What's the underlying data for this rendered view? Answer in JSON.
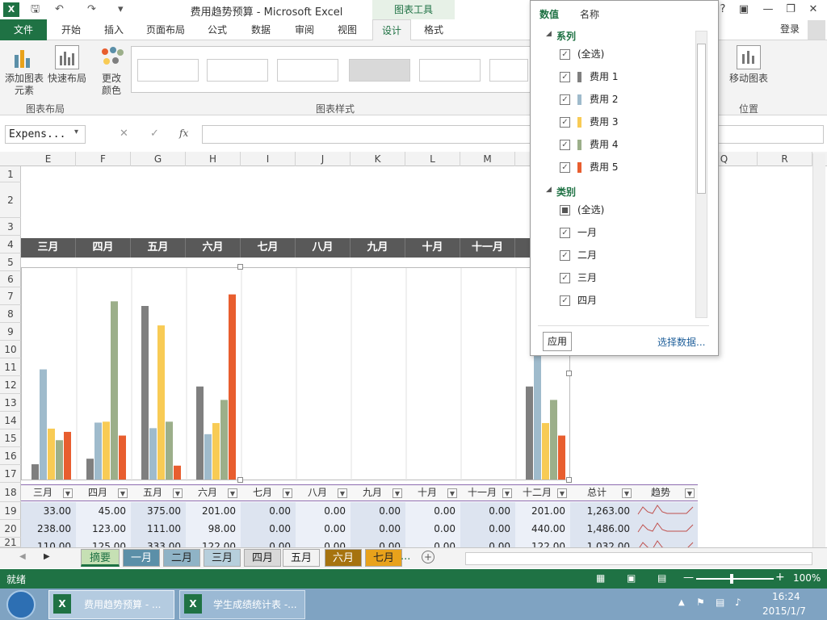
{
  "window": {
    "title": "费用趋势预算 - Microsoft Excel",
    "context_tab": "图表工具",
    "login": "登录"
  },
  "tabs": [
    "文件",
    "开始",
    "插入",
    "页面布局",
    "公式",
    "数据",
    "审阅",
    "视图",
    "设计",
    "格式"
  ],
  "ribbon": {
    "add_element": "添加图表\n元素",
    "quick_layout": "快速布局",
    "change_color": "更改\n颜色",
    "group_layout": "图表布局",
    "group_styles": "图表样式",
    "move_chart": "移动图表",
    "group_position": "位置"
  },
  "formula_bar": {
    "name_box": "Expens...",
    "fx": "fx"
  },
  "columns": [
    "E",
    "F",
    "G",
    "H",
    "I",
    "J",
    "K",
    "L",
    "M",
    "N",
    "O",
    "P",
    "Q",
    "R"
  ],
  "rows": [
    "1",
    "2",
    "3",
    "4",
    "5",
    "6",
    "7",
    "8",
    "9",
    "10",
    "11",
    "12",
    "13",
    "14",
    "15",
    "16",
    "17",
    "18",
    "19",
    "20",
    "21"
  ],
  "month_header": [
    "三月",
    "四月",
    "五月",
    "六月",
    "七月",
    "八月",
    "九月",
    "十月",
    "十一月",
    "十"
  ],
  "chart_data": {
    "type": "bar",
    "categories": [
      "三月",
      "四月",
      "五月",
      "六月",
      "七月",
      "八月",
      "九月",
      "十月",
      "十一月",
      "十二月"
    ],
    "series": [
      {
        "name": "费用 1",
        "color": "#7f7f7f",
        "values": [
          33,
          45,
          375,
          201,
          0,
          0,
          0,
          0,
          0,
          201
        ]
      },
      {
        "name": "费用 2",
        "color": "#9fbbcc",
        "values": [
          238,
          123,
          111,
          98,
          0,
          0,
          0,
          0,
          0,
          440
        ]
      },
      {
        "name": "费用 3",
        "color": "#f8cb55",
        "values": [
          110,
          125,
          333,
          122,
          0,
          0,
          0,
          0,
          0,
          122
        ]
      },
      {
        "name": "费用 4",
        "color": "#9caf8a",
        "values": [
          85,
          385,
          125,
          172,
          0,
          0,
          0,
          0,
          0,
          172
        ]
      },
      {
        "name": "费用 5",
        "color": "#e85e2f",
        "values": [
          103,
          95,
          30,
          400,
          0,
          0,
          0,
          0,
          0,
          95
        ]
      }
    ],
    "ylim": [
      0,
      450
    ]
  },
  "table": {
    "headers": [
      "三月",
      "四月",
      "五月",
      "六月",
      "七月",
      "八月",
      "九月",
      "十月",
      "十一月",
      "十二月",
      "总计",
      "趋势"
    ],
    "rows": [
      [
        "33.00",
        "45.00",
        "375.00",
        "201.00",
        "0.00",
        "0.00",
        "0.00",
        "0.00",
        "0.00",
        "201.00",
        "1,263.00"
      ],
      [
        "238.00",
        "123.00",
        "111.00",
        "98.00",
        "0.00",
        "0.00",
        "0.00",
        "0.00",
        "0.00",
        "440.00",
        "1,486.00"
      ],
      [
        "110.00",
        "125.00",
        "333.00",
        "122.00",
        "0.00",
        "0.00",
        "0.00",
        "0.00",
        "0.00",
        "122.00",
        "1,032.00"
      ]
    ]
  },
  "sheet_tabs": [
    {
      "label": "摘要",
      "color": "#c6e0b4",
      "fg": "#1f7244"
    },
    {
      "label": "一月",
      "color": "#5b8fa8",
      "fg": "#fff"
    },
    {
      "label": "二月",
      "color": "#8fb3c6",
      "fg": "#222"
    },
    {
      "label": "三月",
      "color": "#b7cfdc",
      "fg": "#222"
    },
    {
      "label": "四月",
      "color": "#d9d9d9",
      "fg": "#222"
    },
    {
      "label": "五月",
      "color": "#f3f3f3",
      "fg": "#222"
    },
    {
      "label": "六月",
      "color": "#a6730f",
      "fg": "#fff"
    },
    {
      "label": "七月",
      "color": "#e8a21b",
      "fg": "#222"
    }
  ],
  "sheet_more": "...",
  "status": {
    "ready": "就绪",
    "zoom": "100%"
  },
  "taskbar": {
    "item1": "费用趋势预算 - ...",
    "item2": "学生成绩统计表 -...",
    "time": "16:24",
    "date": "2015/1/7"
  },
  "filter_panel": {
    "tab_values": "数值",
    "tab_names": "名称",
    "section_series": "系列",
    "section_category": "类别",
    "select_all": "(全选)",
    "series": [
      "费用 1",
      "费用 2",
      "费用 3",
      "费用 4",
      "费用 5"
    ],
    "categories": [
      "一月",
      "二月",
      "三月",
      "四月"
    ],
    "apply": "应用",
    "select_data": "选择数据..."
  }
}
